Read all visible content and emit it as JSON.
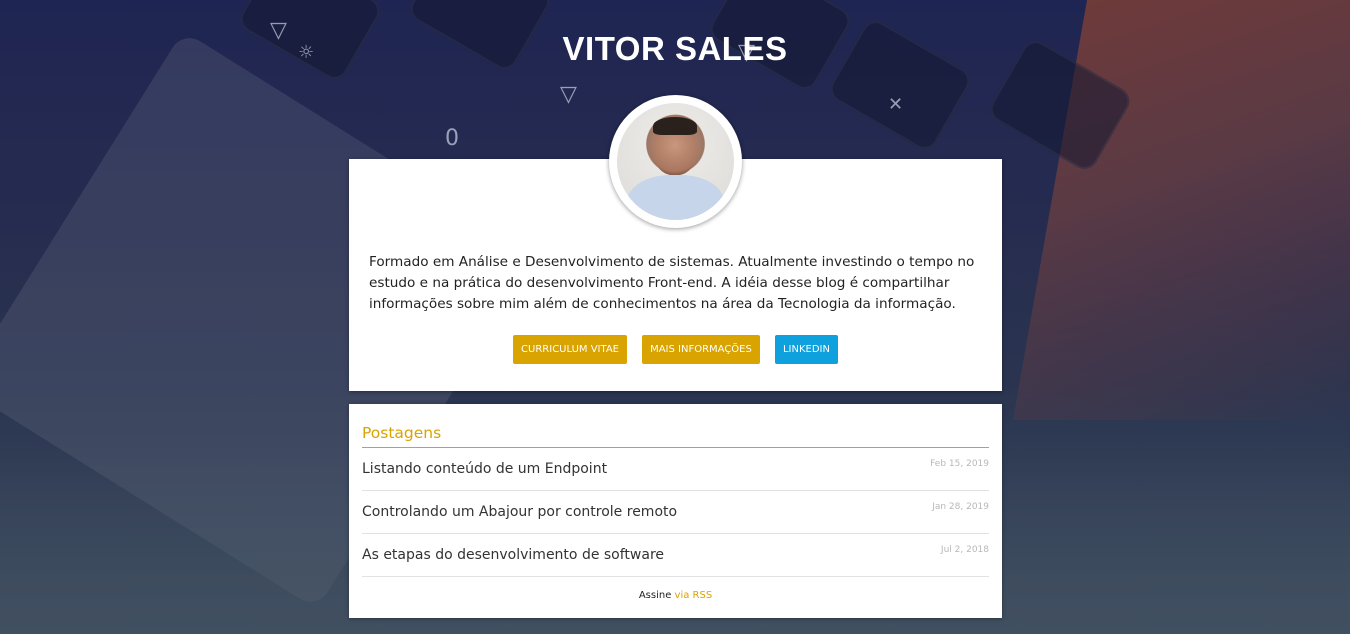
{
  "site": {
    "title": "VITOR SALES"
  },
  "about": {
    "text": "Formado em Análise e Desenvolvimento de sistemas. Atualmente investindo o tempo no estudo e na prática do desenvolvimento Front-end. A idéia desse blog é compartilhar informações sobre mim além de conhecimentos na área da Tecnologia da informação.",
    "buttons": [
      {
        "label": "CURRICULUM VITAE",
        "color": "#d9a300"
      },
      {
        "label": "MAIS INFORMAÇÕES",
        "color": "#d9a300"
      },
      {
        "label": "LINKEDIN",
        "color": "#0ea1dd"
      }
    ]
  },
  "posts": {
    "heading": "Postagens",
    "items": [
      {
        "title": "Listando conteúdo de um Endpoint",
        "date": "Feb 15, 2019"
      },
      {
        "title": "Controlando um Abajour por controle remoto",
        "date": "Jan 28, 2019"
      },
      {
        "title": "As etapas do desenvolvimento de software",
        "date": "Jul 2, 2018"
      }
    ],
    "rss_prefix": "Assine",
    "rss_link": "via RSS"
  }
}
